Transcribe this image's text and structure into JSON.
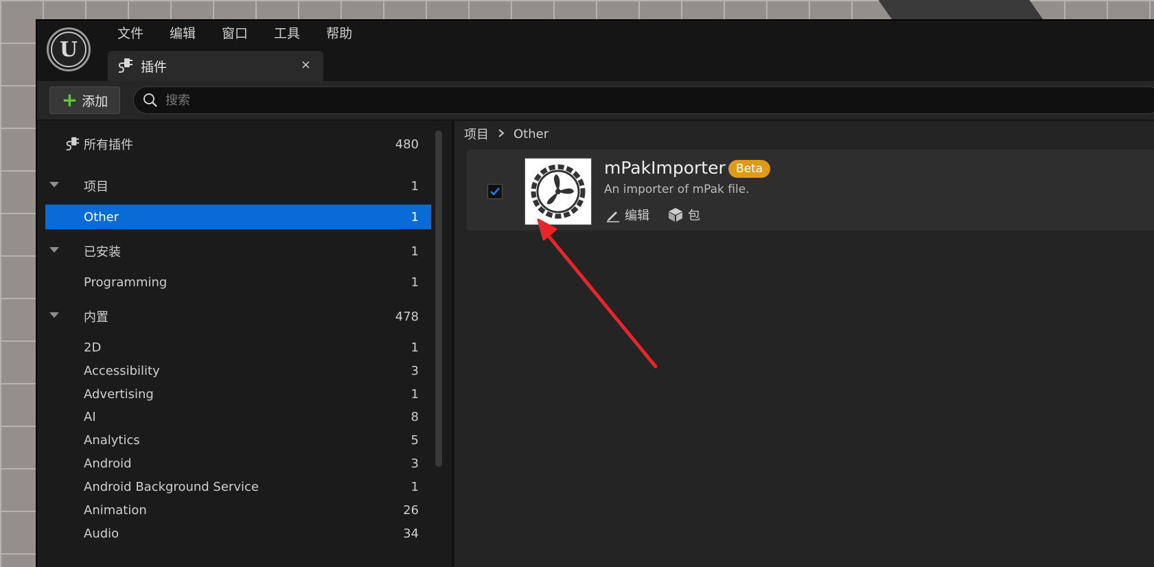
{
  "menubar": {
    "items": [
      "文件",
      "编辑",
      "窗口",
      "工具",
      "帮助"
    ]
  },
  "tab": {
    "label": "插件",
    "close_symbol": "×"
  },
  "toolbar": {
    "add_label": "添加",
    "search_placeholder": "搜索"
  },
  "sidebar": {
    "all": {
      "label": "所有插件",
      "count": "480"
    },
    "rows": [
      {
        "label": "项目",
        "count": "1",
        "type": "group"
      },
      {
        "label": "Other",
        "count": "1",
        "type": "item",
        "selected": true
      },
      {
        "label": "已安装",
        "count": "1",
        "type": "group"
      },
      {
        "label": "Programming",
        "count": "1",
        "type": "item"
      },
      {
        "label": "内置",
        "count": "478",
        "type": "group"
      },
      {
        "label": "2D",
        "count": "1",
        "type": "item"
      },
      {
        "label": "Accessibility",
        "count": "3",
        "type": "item"
      },
      {
        "label": "Advertising",
        "count": "1",
        "type": "item"
      },
      {
        "label": "AI",
        "count": "8",
        "type": "item"
      },
      {
        "label": "Analytics",
        "count": "5",
        "type": "item"
      },
      {
        "label": "Android",
        "count": "3",
        "type": "item"
      },
      {
        "label": "Android Background Service",
        "count": "1",
        "type": "item"
      },
      {
        "label": "Animation",
        "count": "26",
        "type": "item"
      },
      {
        "label": "Audio",
        "count": "34",
        "type": "item"
      }
    ]
  },
  "main": {
    "breadcrumb": {
      "root": "项目",
      "leaf": "Other"
    },
    "plugin": {
      "name": "mPakImporter",
      "badge": "Beta",
      "description": "An importer of mPak file.",
      "enabled": true,
      "edit_label": "编辑",
      "package_label": "包"
    }
  },
  "colors": {
    "selection": "#0a6ad6",
    "badge": "#e09a19",
    "add_plus": "#62c53c",
    "checkmark": "#1e7fe6",
    "annotation_arrow": "#e8262a"
  }
}
